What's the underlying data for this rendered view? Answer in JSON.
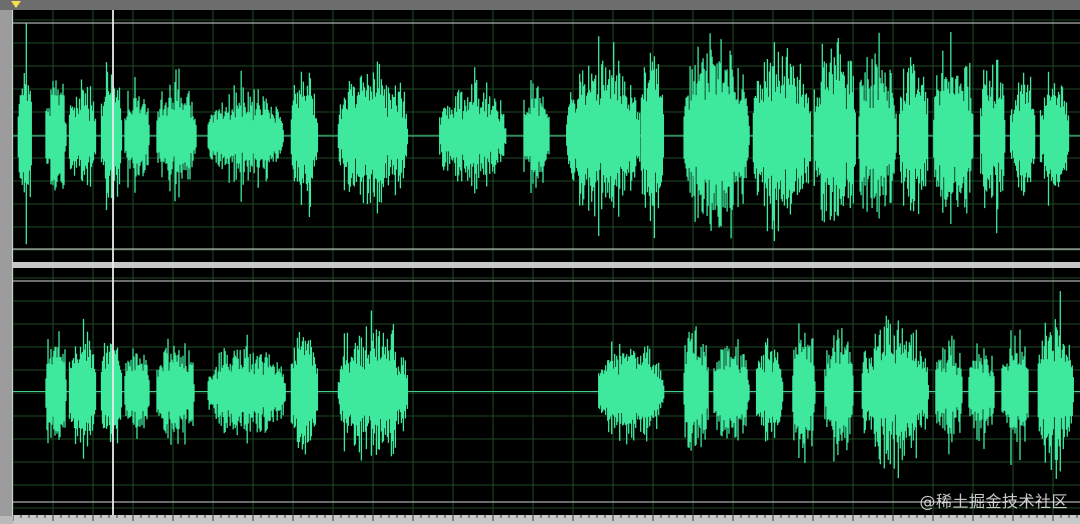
{
  "colors": {
    "waveform": "#3ee89c",
    "grid": "#1e4a24",
    "centerline": "#3fd090",
    "boundary": "#d8d8d8",
    "background": "#000000"
  },
  "channels": [
    {
      "id": "left",
      "segments": [
        [
          0.004,
          0.018,
          0.42
        ],
        [
          0.03,
          0.05,
          0.34
        ],
        [
          0.052,
          0.078,
          0.3
        ],
        [
          0.082,
          0.102,
          0.34
        ],
        [
          0.104,
          0.128,
          0.28
        ],
        [
          0.134,
          0.172,
          0.3
        ],
        [
          0.182,
          0.254,
          0.24
        ],
        [
          0.26,
          0.286,
          0.34
        ],
        [
          0.304,
          0.37,
          0.36
        ],
        [
          0.399,
          0.462,
          0.28
        ],
        [
          0.478,
          0.503,
          0.3
        ],
        [
          0.518,
          0.588,
          0.4
        ],
        [
          0.588,
          0.61,
          0.5
        ],
        [
          0.628,
          0.69,
          0.48
        ],
        [
          0.693,
          0.748,
          0.46
        ],
        [
          0.75,
          0.79,
          0.5
        ],
        [
          0.792,
          0.828,
          0.46
        ],
        [
          0.83,
          0.858,
          0.44
        ],
        [
          0.862,
          0.9,
          0.46
        ],
        [
          0.906,
          0.93,
          0.4
        ],
        [
          0.934,
          0.958,
          0.36
        ],
        [
          0.962,
          0.99,
          0.34
        ]
      ]
    },
    {
      "id": "right",
      "segments": [
        [
          0.03,
          0.05,
          0.36
        ],
        [
          0.052,
          0.078,
          0.34
        ],
        [
          0.082,
          0.102,
          0.32
        ],
        [
          0.104,
          0.128,
          0.28
        ],
        [
          0.134,
          0.17,
          0.3
        ],
        [
          0.182,
          0.256,
          0.24
        ],
        [
          0.26,
          0.286,
          0.34
        ],
        [
          0.304,
          0.37,
          0.36
        ],
        [
          0.548,
          0.61,
          0.28
        ],
        [
          0.628,
          0.652,
          0.34
        ],
        [
          0.656,
          0.69,
          0.32
        ],
        [
          0.696,
          0.722,
          0.3
        ],
        [
          0.73,
          0.752,
          0.36
        ],
        [
          0.76,
          0.788,
          0.32
        ],
        [
          0.795,
          0.858,
          0.38
        ],
        [
          0.864,
          0.89,
          0.28
        ],
        [
          0.895,
          0.92,
          0.28
        ],
        [
          0.926,
          0.952,
          0.3
        ],
        [
          0.96,
          0.994,
          0.4
        ]
      ]
    }
  ],
  "watermark": "@稀土掘金技术社区"
}
